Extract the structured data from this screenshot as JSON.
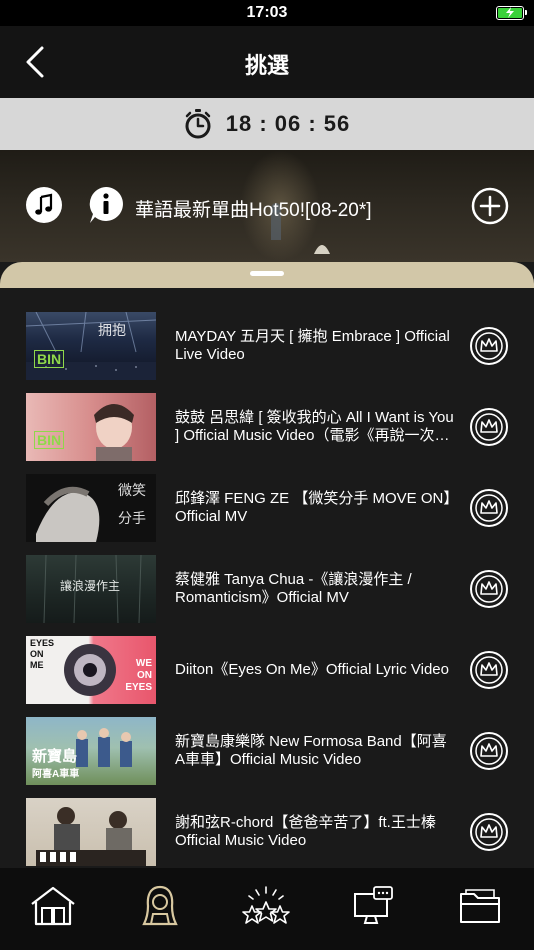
{
  "status_bar": {
    "time": "17:03"
  },
  "nav": {
    "title": "挑選"
  },
  "timer": {
    "text": "18 : 06 : 56"
  },
  "playlist": {
    "title": "華語最新單曲Hot50![08-20*]"
  },
  "songs": [
    {
      "title": "MAYDAY 五月天 [ 擁抱 Embrace ] Official Live Video"
    },
    {
      "title": "鼓鼓 呂思緯 [ 簽收我的心 All I Want is You ] Official Music Video（電影《再說一次我願意》主題曲）"
    },
    {
      "title": "邱鋒澤 FENG ZE 【微笑分手 MOVE ON】Official MV"
    },
    {
      "title": "蔡健雅 Tanya Chua -《讓浪漫作主 / Romanticism》Official MV"
    },
    {
      "title": "Diiton《Eyes On Me》Official Lyric Video"
    },
    {
      "title": "新寶島康樂隊 New Formosa Band【阿喜A車車】Official Music Video"
    },
    {
      "title": "謝和弦R-chord【爸爸辛苦了】ft.王士榛 Official Music Video"
    }
  ],
  "thumbnails": {
    "t1": "拥抱",
    "t1b": "BIN",
    "t2": "BIN",
    "t3a": "微笑",
    "t3b": "分手",
    "t4": "讓浪漫作主",
    "t5a": "EYES",
    "t5b": "ON",
    "t5c": "ME",
    "t5d": "WE",
    "t5e": "ON",
    "t5f": "EYES",
    "t6": "新寶島",
    "t6b": "阿喜A車車"
  },
  "tabs": [
    {
      "icon": "home-icon"
    },
    {
      "icon": "singer-icon"
    },
    {
      "icon": "stars-icon"
    },
    {
      "icon": "monitor-icon"
    },
    {
      "icon": "folder-icon"
    }
  ],
  "colors": {
    "timer_bg": "#d7d7d7",
    "sheet_accent": "#d2c7a8",
    "active_tab": "#d8c8a0",
    "battery": "#3ad13a"
  }
}
